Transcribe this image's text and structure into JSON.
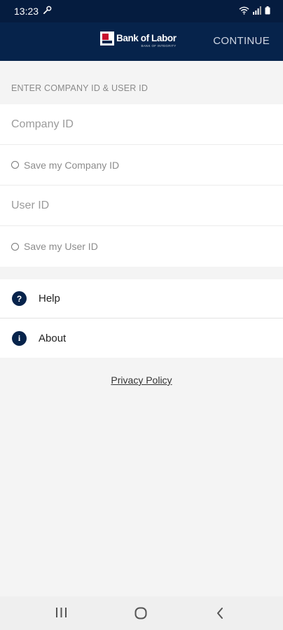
{
  "status_bar": {
    "time": "13:23",
    "icons": [
      "wrench-icon",
      "wifi-icon",
      "signal-icon",
      "battery-icon"
    ]
  },
  "header": {
    "logo_name": "Bank of Labor",
    "logo_tagline": "BANK OF INTEGRITY",
    "continue_label": "CONTINUE"
  },
  "login": {
    "section_title": "ENTER COMPANY ID & USER ID",
    "company_id_placeholder": "Company ID",
    "save_company_label": "Save my Company ID",
    "user_id_placeholder": "User ID",
    "save_user_label": "Save my User ID"
  },
  "menu": {
    "items": [
      {
        "label": "Help",
        "icon": "question-icon",
        "glyph": "?"
      },
      {
        "label": "About",
        "icon": "info-icon",
        "glyph": "i"
      }
    ]
  },
  "footer": {
    "privacy_label": "Privacy Policy"
  },
  "colors": {
    "brand_navy": "#06234b",
    "status_bar": "#051c3f",
    "background": "#f4f4f4",
    "logo_red": "#c8102e"
  },
  "nav_bar": {
    "icons": [
      "recent-apps-icon",
      "home-icon",
      "back-icon"
    ]
  }
}
